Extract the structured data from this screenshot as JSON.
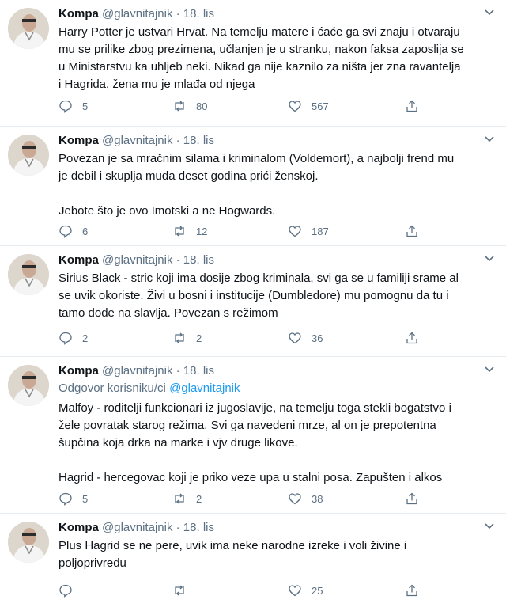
{
  "tweets": [
    {
      "name": "Kompa",
      "handle": "@glavnitajnik",
      "dot": "·",
      "date": "18. lis",
      "reply_prefix": "",
      "reply_mention": "",
      "text": "Harry Potter je ustvari Hrvat. Na temelju matere i ćaće ga svi znaju i otvaraju\nmu se prilike zbog prezimena, učlanjen je u stranku, nakon faksa zaposlija se\nu Ministarstvu ka uhljeb neki. Nikad ga nije kaznilo za ništa jer zna ravantelja\ni Hagrida, žena mu je mlađa od njega",
      "replies": "5",
      "retweets": "80",
      "likes": "567"
    },
    {
      "name": "Kompa",
      "handle": "@glavnitajnik",
      "dot": "·",
      "date": "18. lis",
      "reply_prefix": "",
      "reply_mention": "",
      "text": "Povezan je sa mračnim silama i kriminalom (Voldemort), a najbolji frend mu\nje debil i skuplja muda deset godina prići ženskoj.\n\nJebote što je ovo Imotski a ne Hogwards.",
      "replies": "6",
      "retweets": "12",
      "likes": "187"
    },
    {
      "name": "Kompa",
      "handle": "@glavnitajnik",
      "dot": "·",
      "date": "18. lis",
      "reply_prefix": "",
      "reply_mention": "",
      "text": "Sirius Black - stric koji ima dosije zbog kriminala, svi ga se u familiji srame al\nse uvik okoriste. Živi u bosni i institucije (Dumbledore) mu pomognu da tu i\ntamo dođe na slavlja. Povezan s režimom",
      "replies": "2",
      "retweets": "2",
      "likes": "36"
    },
    {
      "name": "Kompa",
      "handle": "@glavnitajnik",
      "dot": "·",
      "date": "18. lis",
      "reply_prefix": "Odgovor korisniku/ci ",
      "reply_mention": "@glavnitajnik",
      "text": "Malfoy - roditelji funkcionari iz jugoslavije, na temelju toga stekli bogatstvo i\nžele povratak starog režima. Svi ga navedeni mrze, al on je prepotentna\nšupčina koja drka na marke i vjv druge likove.\n\nHagrid - hercegovac koji je priko veze upa u stalni posa. Zapušten i alkos",
      "replies": "5",
      "retweets": "2",
      "likes": "38"
    },
    {
      "name": "Kompa",
      "handle": "@glavnitajnik",
      "dot": "·",
      "date": "18. lis",
      "reply_prefix": "",
      "reply_mention": "",
      "text": "Plus Hagrid se ne pere, uvik ima neke narodne izreke i voli živine i\npoljoprivredu",
      "replies": "",
      "retweets": "",
      "likes": "25"
    }
  ],
  "icons": {
    "reply": "reply-icon",
    "retweet": "retweet-icon",
    "like": "heart-icon",
    "share": "share-icon",
    "more": "chevron-down-icon",
    "avatar": "avatar"
  },
  "colors": {
    "text": "#0f1419",
    "muted": "#5b7083",
    "mention": "#1d9bf0",
    "divider": "#e6ecf0"
  }
}
